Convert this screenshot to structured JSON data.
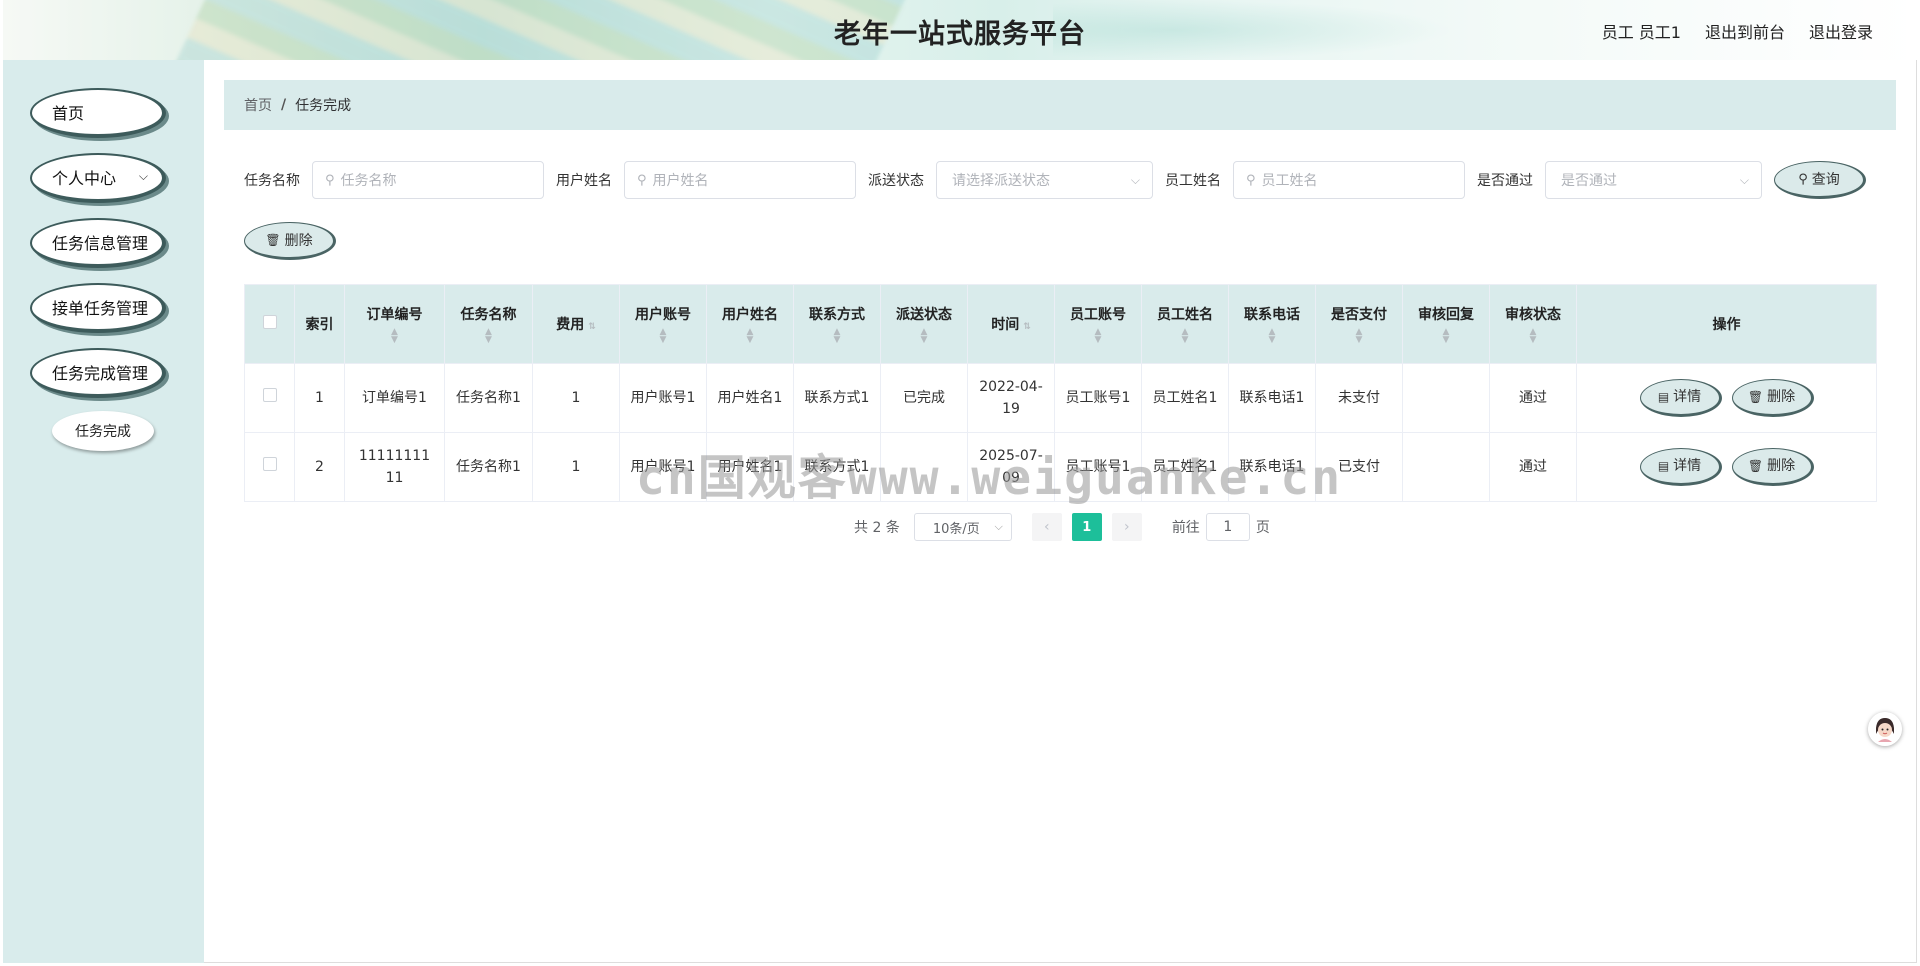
{
  "header": {
    "site_title": "老年一站式服务平台",
    "user_label": "员工 员工1",
    "front_link": "退出到前台",
    "logout_link": "退出登录"
  },
  "sidebar": {
    "items": [
      {
        "label": "首页"
      },
      {
        "label": "个人中心",
        "has_submenu": true
      },
      {
        "label": "任务信息管理"
      },
      {
        "label": "接单任务管理"
      },
      {
        "label": "任务完成管理"
      }
    ],
    "active_subitem": "任务完成"
  },
  "breadcrumb": {
    "home": "首页",
    "separator": "/",
    "current": "任务完成"
  },
  "search": {
    "task_name_label": "任务名称",
    "task_name_placeholder": "任务名称",
    "user_name_label": "用户姓名",
    "user_name_placeholder": "用户姓名",
    "dispatch_label": "派送状态",
    "dispatch_placeholder": "请选择派送状态",
    "staff_name_label": "员工姓名",
    "staff_name_placeholder": "员工姓名",
    "approved_label": "是否通过",
    "approved_placeholder": "是否通过",
    "search_button": "查询",
    "delete_button": "删除"
  },
  "table": {
    "headers": [
      "索引",
      "订单编号",
      "任务名称",
      "费用",
      "用户账号",
      "用户姓名",
      "联系方式",
      "派送状态",
      "时间",
      "员工账号",
      "员工姓名",
      "联系电话",
      "是否支付",
      "审核回复",
      "审核状态",
      "操作"
    ],
    "rows": [
      {
        "index": "1",
        "order_no": "订单编号1",
        "task_name": "任务名称1",
        "fee": "1",
        "user_account": "用户账号1",
        "user_name": "用户姓名1",
        "contact": "联系方式1",
        "dispatch": "已完成",
        "time": "2022-04-19",
        "staff_account": "员工账号1",
        "staff_name": "员工姓名1",
        "phone": "联系电话1",
        "paid": "未支付",
        "reply": "",
        "status": "通过"
      },
      {
        "index": "2",
        "order_no": "1111111111",
        "task_name": "任务名称1",
        "fee": "1",
        "user_account": "用户账号1",
        "user_name": "用户姓名1",
        "contact": "联系方式1",
        "dispatch": "",
        "time": "2025-07-09",
        "staff_account": "员工账号1",
        "staff_name": "员工姓名1",
        "phone": "联系电话1",
        "paid": "已支付",
        "reply": "",
        "status": "通过"
      }
    ],
    "detail_button": "详情",
    "delete_button": "删除"
  },
  "pagination": {
    "total_text": "共 2 条",
    "page_size": "10条/页",
    "current_page": "1",
    "goto_prefix": "前往",
    "goto_value": "1",
    "goto_suffix": "页"
  },
  "watermark": "cn国观客www.weiguanke.cn",
  "colors": {
    "sidebar_bg": "#d9ecec",
    "header_bg": "#d9ebeb",
    "accent": "#1dbf9a",
    "pill_border": "#3d5b5b"
  }
}
